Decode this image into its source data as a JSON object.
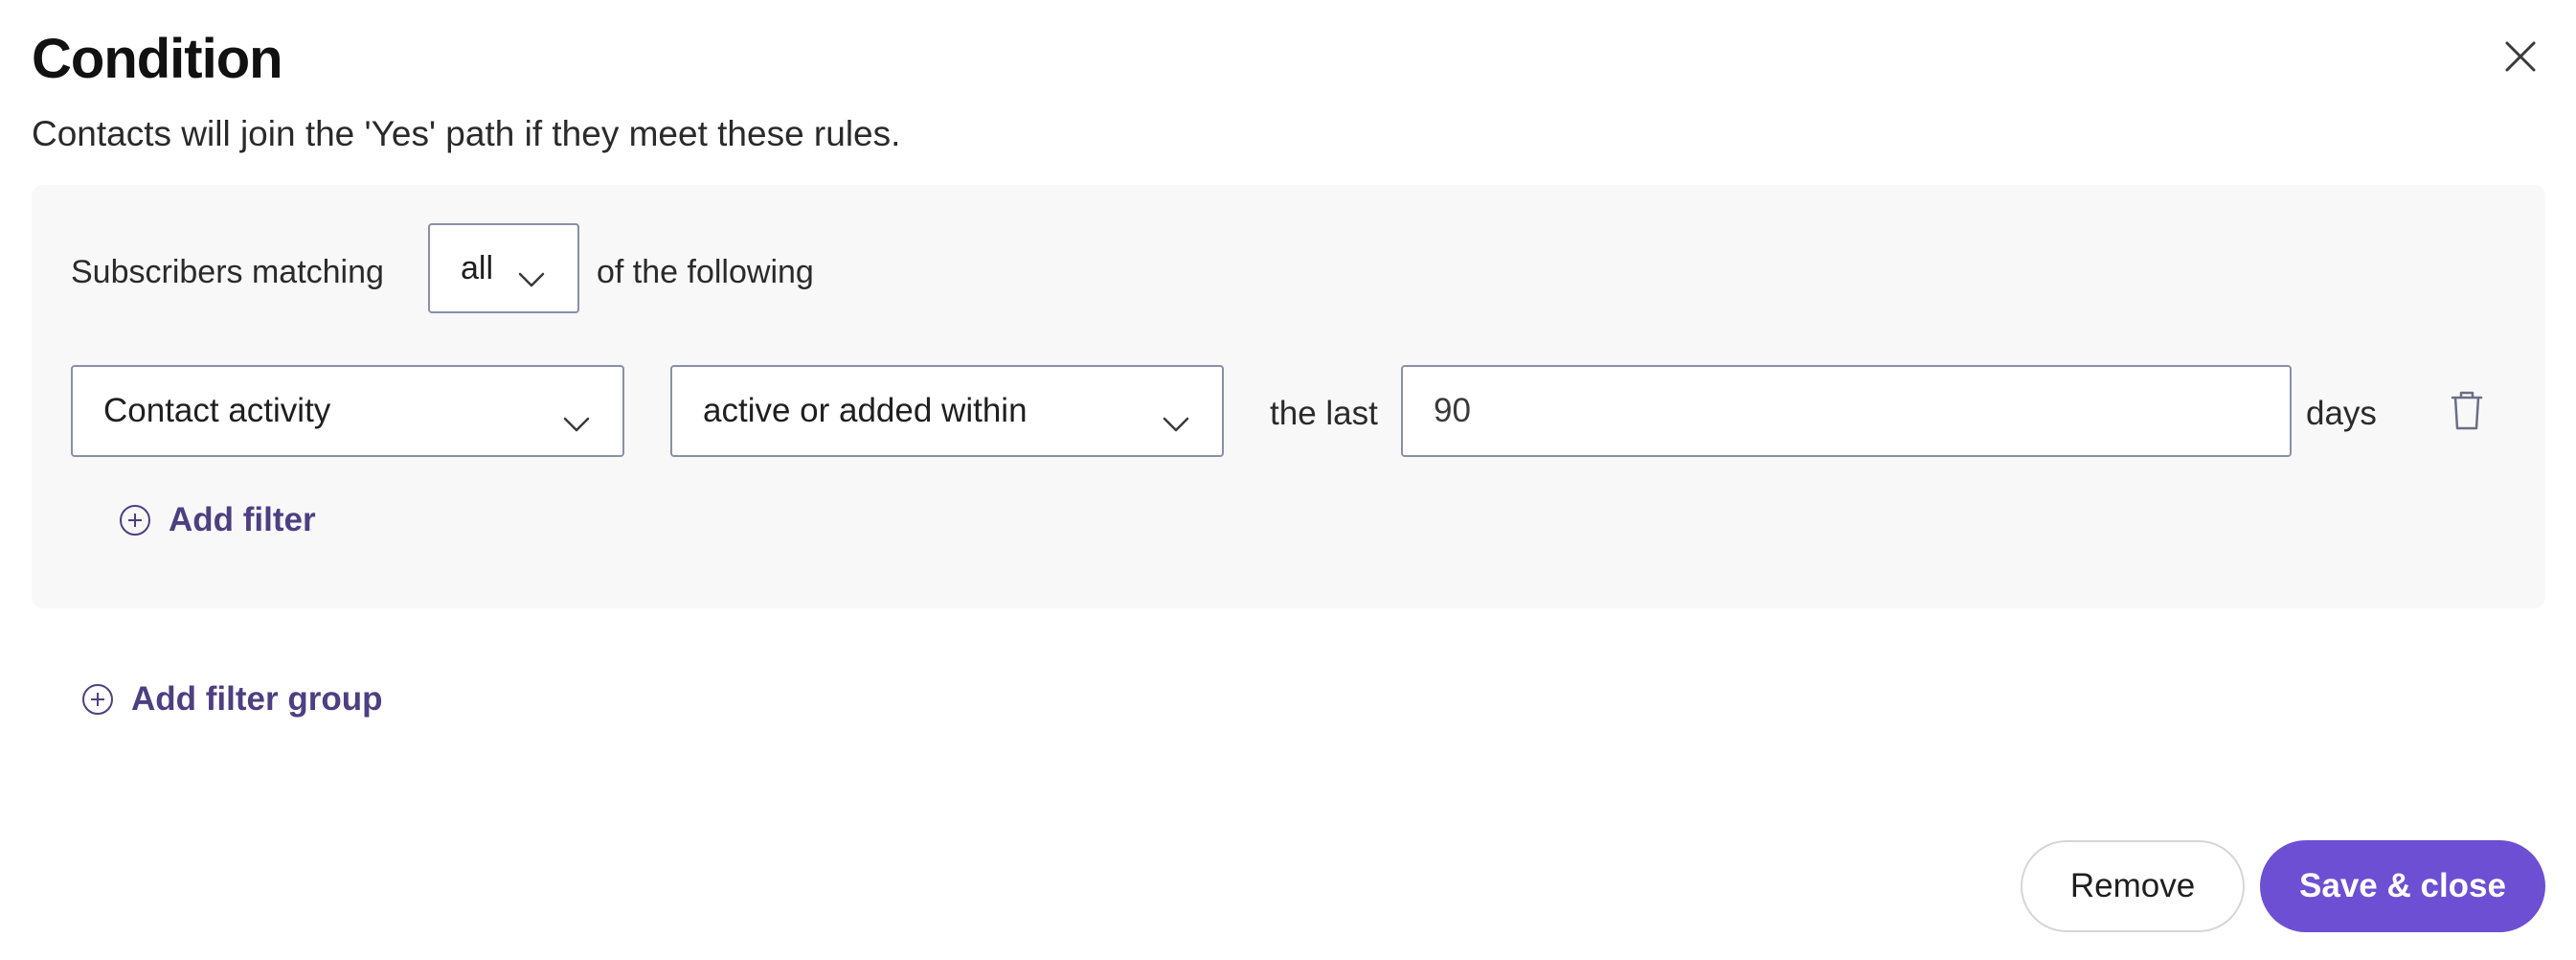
{
  "header": {
    "title": "Condition",
    "subtitle": "Contacts will join the 'Yes' path if they meet these rules.",
    "close_icon": "close-icon"
  },
  "rule_group": {
    "matching_prefix": "Subscribers matching",
    "match_value": "all",
    "matching_suffix": "of the following",
    "filter": {
      "field_value": "Contact activity",
      "operator_value": "active or added within",
      "range_label": "the last",
      "days_value": "90",
      "unit_label": "days",
      "delete_icon": "trash-icon"
    },
    "add_filter_label": "Add filter"
  },
  "add_filter_group_label": "Add filter group",
  "footer": {
    "remove_label": "Remove",
    "save_label": "Save & close"
  },
  "colors": {
    "accent": "#6c4fd3",
    "link": "#4e3f82",
    "panel_bg": "#f8f8f8",
    "border": "#8a8fa8"
  }
}
